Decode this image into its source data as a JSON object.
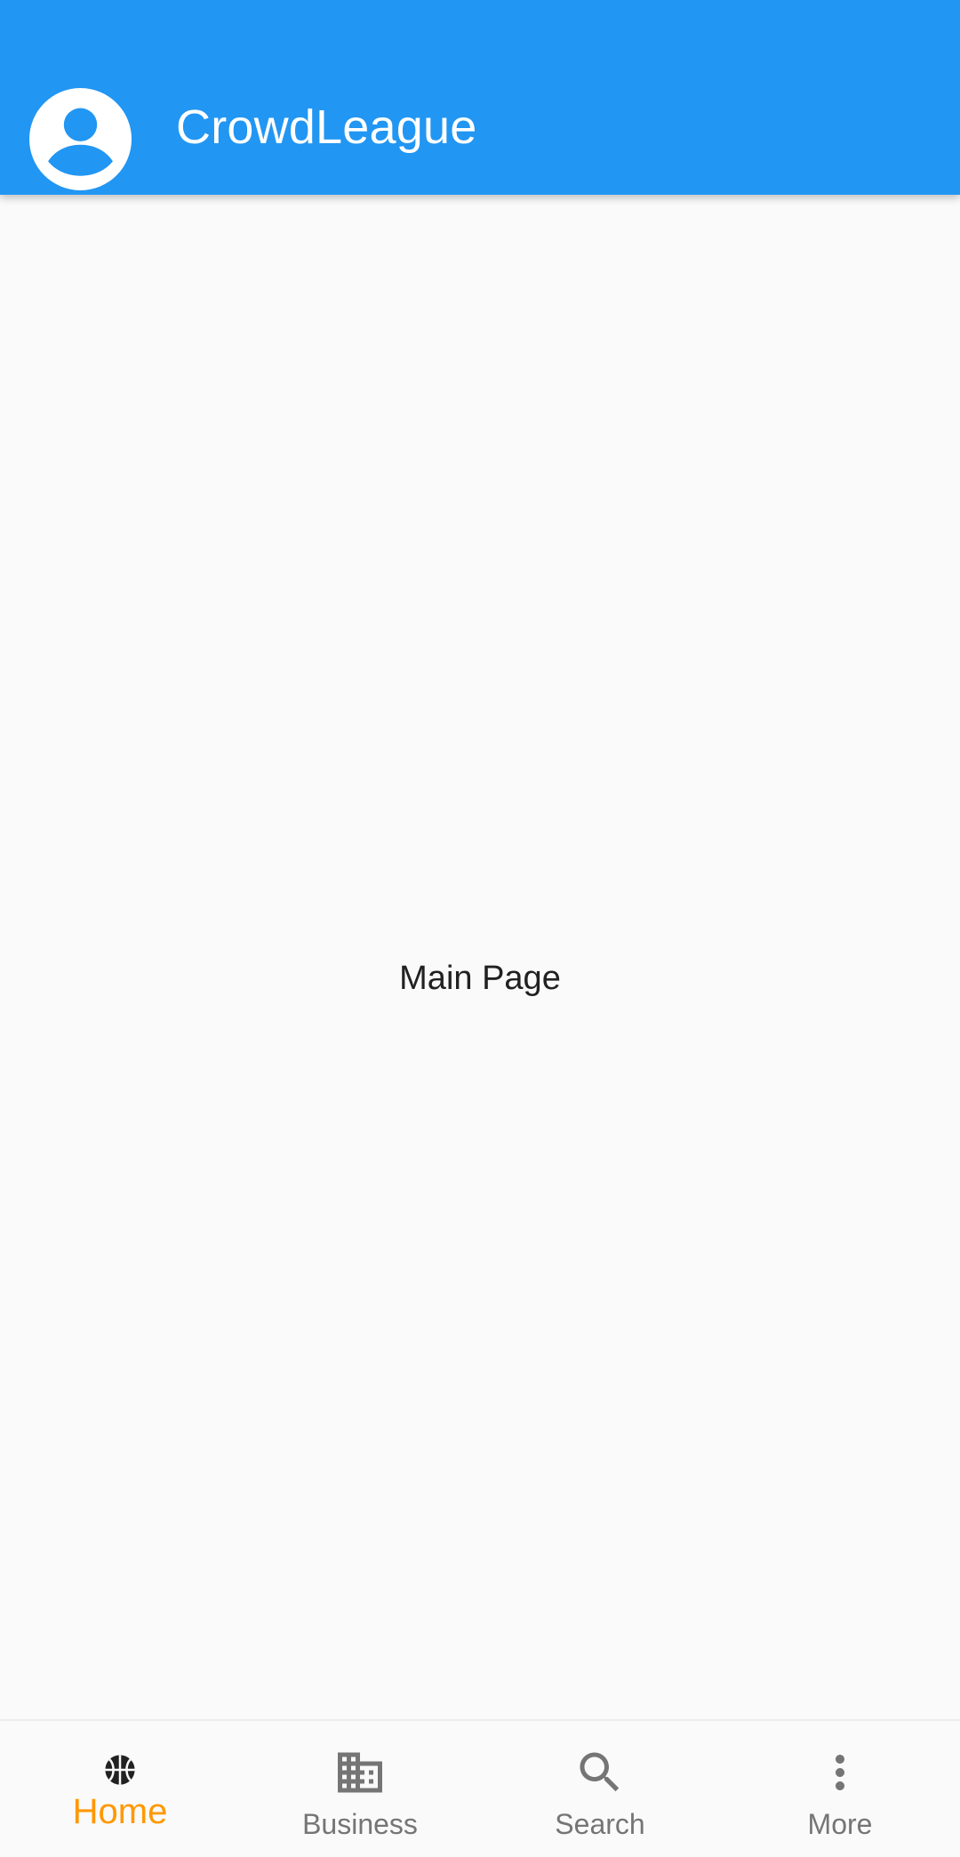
{
  "app_bar": {
    "title": "CrowdLeague",
    "avatar_icon": "account-circle-icon",
    "background_color": "#2196f3"
  },
  "main": {
    "text": "Main Page"
  },
  "bottom_nav": {
    "active_color": "#ff9800",
    "inactive_color": "#757575",
    "items": [
      {
        "label": "Home",
        "icon": "basketball-icon",
        "active": true
      },
      {
        "label": "Business",
        "icon": "business-building-icon",
        "active": false
      },
      {
        "label": "Search",
        "icon": "search-icon",
        "active": false
      },
      {
        "label": "More",
        "icon": "more-vertical-icon",
        "active": false
      }
    ]
  }
}
